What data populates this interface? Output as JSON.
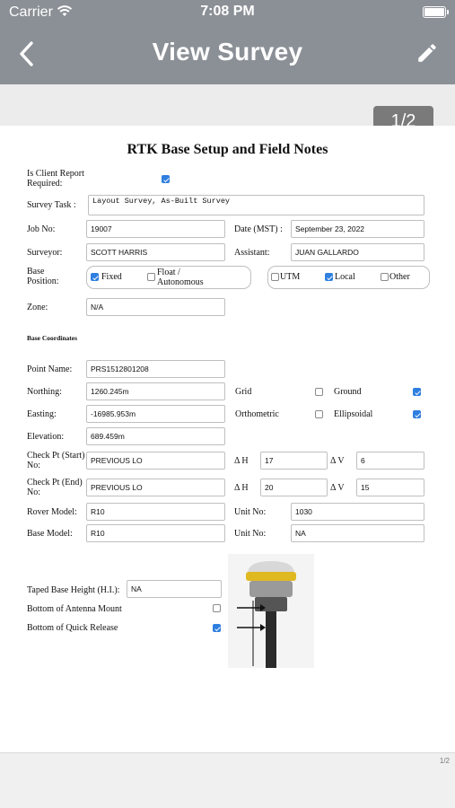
{
  "status_bar": {
    "carrier": "Carrier",
    "time": "7:08 PM"
  },
  "nav": {
    "title": "View Survey",
    "back_icon": "chevron-left-icon",
    "edit_icon": "pencil-icon"
  },
  "page_indicator": "1/2",
  "document": {
    "title": "RTK Base Setup and Field Notes",
    "client_report": {
      "label": "Is Client Report Required:",
      "checked": true
    },
    "survey_task": {
      "label": "Survey Task :",
      "value": "Layout Survey, As-Built Survey"
    },
    "job_no": {
      "label": "Job No:",
      "value": "19007"
    },
    "date": {
      "label": "Date (MST) :",
      "value": "September 23, 2022"
    },
    "surveyor": {
      "label": "Surveyor:",
      "value": "SCOTT HARRIS"
    },
    "assistant": {
      "label": "Assistant:",
      "value": "JUAN GALLARDO"
    },
    "base_position": {
      "label": "Base Position:",
      "fixed": {
        "label": "Fixed",
        "checked": true
      },
      "float": {
        "label": "Float / Autonomous",
        "checked": false
      },
      "utm": {
        "label": "UTM",
        "checked": false
      },
      "local": {
        "label": "Local",
        "checked": true
      },
      "other": {
        "label": "Other",
        "checked": false
      }
    },
    "zone": {
      "label": "Zone:",
      "value": "N/A"
    },
    "base_coordinates_heading": "Base Coordinates",
    "point_name": {
      "label": "Point Name:",
      "value": "PRS1512801208"
    },
    "northing": {
      "label": "Northing:",
      "value": "1260.245m"
    },
    "easting": {
      "label": "Easting:",
      "value": "-16985.953m"
    },
    "elevation": {
      "label": "Elevation:",
      "value": "689.459m"
    },
    "grid": {
      "label": "Grid",
      "checked": false
    },
    "ground": {
      "label": "Ground",
      "checked": true
    },
    "orthometric": {
      "label": "Orthometric",
      "checked": false
    },
    "ellipsoidal": {
      "label": "Ellipsoidal",
      "checked": true
    },
    "check_start": {
      "label": "Check Pt (Start) No:",
      "value": "PREVIOUS LO",
      "dh": "17",
      "dv": "6"
    },
    "check_end": {
      "label": "Check Pt (End) No:",
      "value": "PREVIOUS LO",
      "dh": "20",
      "dv": "15"
    },
    "delta_h_label": "Δ H",
    "delta_v_label": "Δ V",
    "rover_model": {
      "label": "Rover Model:",
      "value": "R10"
    },
    "rover_unit_no": {
      "label": "Unit No:",
      "value": "1030"
    },
    "base_model": {
      "label": "Base Model:",
      "value": "R10"
    },
    "base_unit_no": {
      "label": "Unit No:",
      "value": "NA"
    },
    "taped_height": {
      "label": "Taped Base Height (H.I.):",
      "value": "NA"
    },
    "bottom_antenna": {
      "label": "Bottom of Antenna Mount",
      "checked": false
    },
    "bottom_quick": {
      "label": "Bottom of Quick Release",
      "checked": true
    }
  },
  "footer_page": "1/2",
  "colors": {
    "nav_bg": "#8b9096",
    "checkbox_on": "#2f7fe0",
    "badge_bg": "#7a7a7a"
  }
}
